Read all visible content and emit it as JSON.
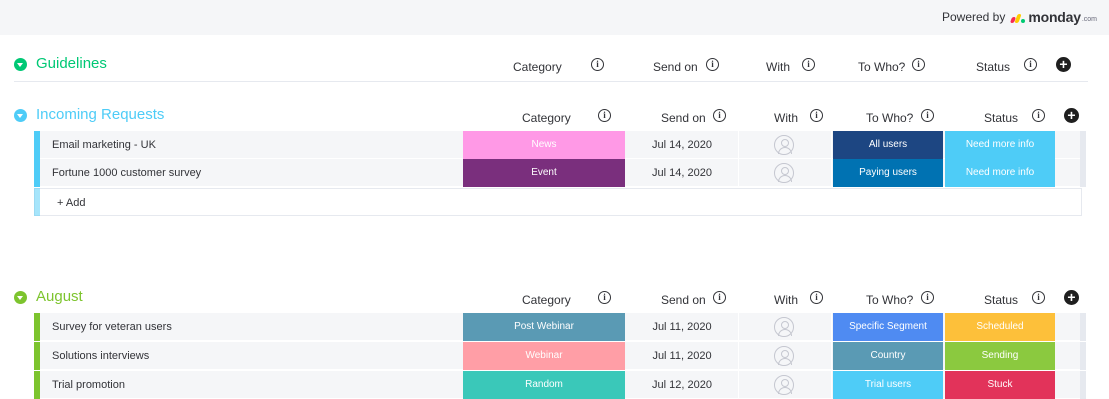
{
  "powered_by": {
    "label": "Powered by",
    "brand": "monday",
    "brand_suffix": ".com"
  },
  "columns": {
    "category": "Category",
    "send_on": "Send on",
    "with": "With",
    "to_who": "To Who?",
    "status": "Status"
  },
  "groups": [
    {
      "title": "Guidelines",
      "color": "#00c875",
      "rows": []
    },
    {
      "title": "Incoming Requests",
      "color": "#4eccf7",
      "add_label": "+ Add",
      "rows": [
        {
          "name": "Email marketing - UK",
          "category": "News",
          "category_color": "#ff99e6",
          "send_on": "Jul 14, 2020",
          "to_who": "All users",
          "to_who_color": "#1d4682",
          "status": "Need more info",
          "status_color": "#4eccf7"
        },
        {
          "name": "Fortune 1000 customer survey",
          "category": "Event",
          "category_color": "#7a2f7d",
          "send_on": "Jul 14, 2020",
          "to_who": "Paying users",
          "to_who_color": "#0072b2",
          "status": "Need more info",
          "status_color": "#4eccf7"
        }
      ]
    },
    {
      "title": "August",
      "color": "#7dc42e",
      "rows": [
        {
          "name": "Survey for veteran users",
          "category": "Post Webinar",
          "category_color": "#5a9ab4",
          "send_on": "Jul 11, 2020",
          "to_who": "Specific Segment",
          "to_who_color": "#4f8bf2",
          "status": "Scheduled",
          "status_color": "#fdc03a"
        },
        {
          "name": "Solutions interviews",
          "category": "Webinar",
          "category_color": "#ff9ea6",
          "send_on": "Jul 11, 2020",
          "to_who": "Country",
          "to_who_color": "#5a9ab4",
          "status": "Sending",
          "status_color": "#8bc93f"
        },
        {
          "name": "Trial promotion",
          "category": "Random",
          "category_color": "#3ac8b9",
          "send_on": "Jul 12, 2020",
          "to_who": "Trial users",
          "to_who_color": "#4eccf7",
          "status": "Stuck",
          "status_color": "#e2335a"
        }
      ]
    }
  ]
}
